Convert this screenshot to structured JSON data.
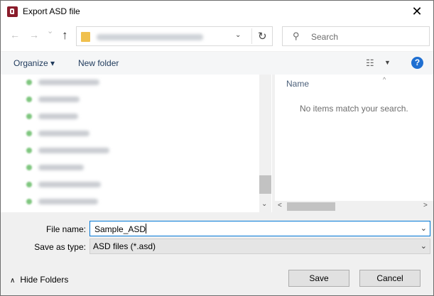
{
  "window": {
    "title": "Export ASD file",
    "close_symbol": "✕"
  },
  "navbar": {
    "back_symbol": "←",
    "forward_symbol": "→",
    "recent_symbol": "⌄",
    "up_symbol": "↑",
    "address_dropdown_symbol": "⌄",
    "refresh_symbol": "↻",
    "search_placeholder": "Search",
    "search_symbol": "⚲"
  },
  "toolbar": {
    "organize_label": "Organize ▾",
    "new_folder_label": "New folder",
    "view_symbol": "☷",
    "view_dropdown_symbol": "▼",
    "help_symbol": "?"
  },
  "nav_pane": {
    "down_symbol": "⌄"
  },
  "file_pane": {
    "column_name": "Name",
    "sort_symbol": "^",
    "empty_message": "No items match your search.",
    "left_symbol": "<",
    "right_symbol": ">"
  },
  "form": {
    "file_name_label": "File name:",
    "file_name_value": "Sample_ASD",
    "save_as_type_label": "Save as type:",
    "save_as_type_value": "ASD files (*.asd)",
    "dropdown_symbol": "⌄"
  },
  "footer": {
    "hide_folders_symbol": "∧",
    "hide_folders_label": "Hide Folders",
    "save_label": "Save",
    "cancel_label": "Cancel"
  },
  "colors": {
    "accent": "#0078d7",
    "help": "#1f6fd1",
    "app_icon": "#8a1c2b",
    "link_text": "#1e395b"
  }
}
